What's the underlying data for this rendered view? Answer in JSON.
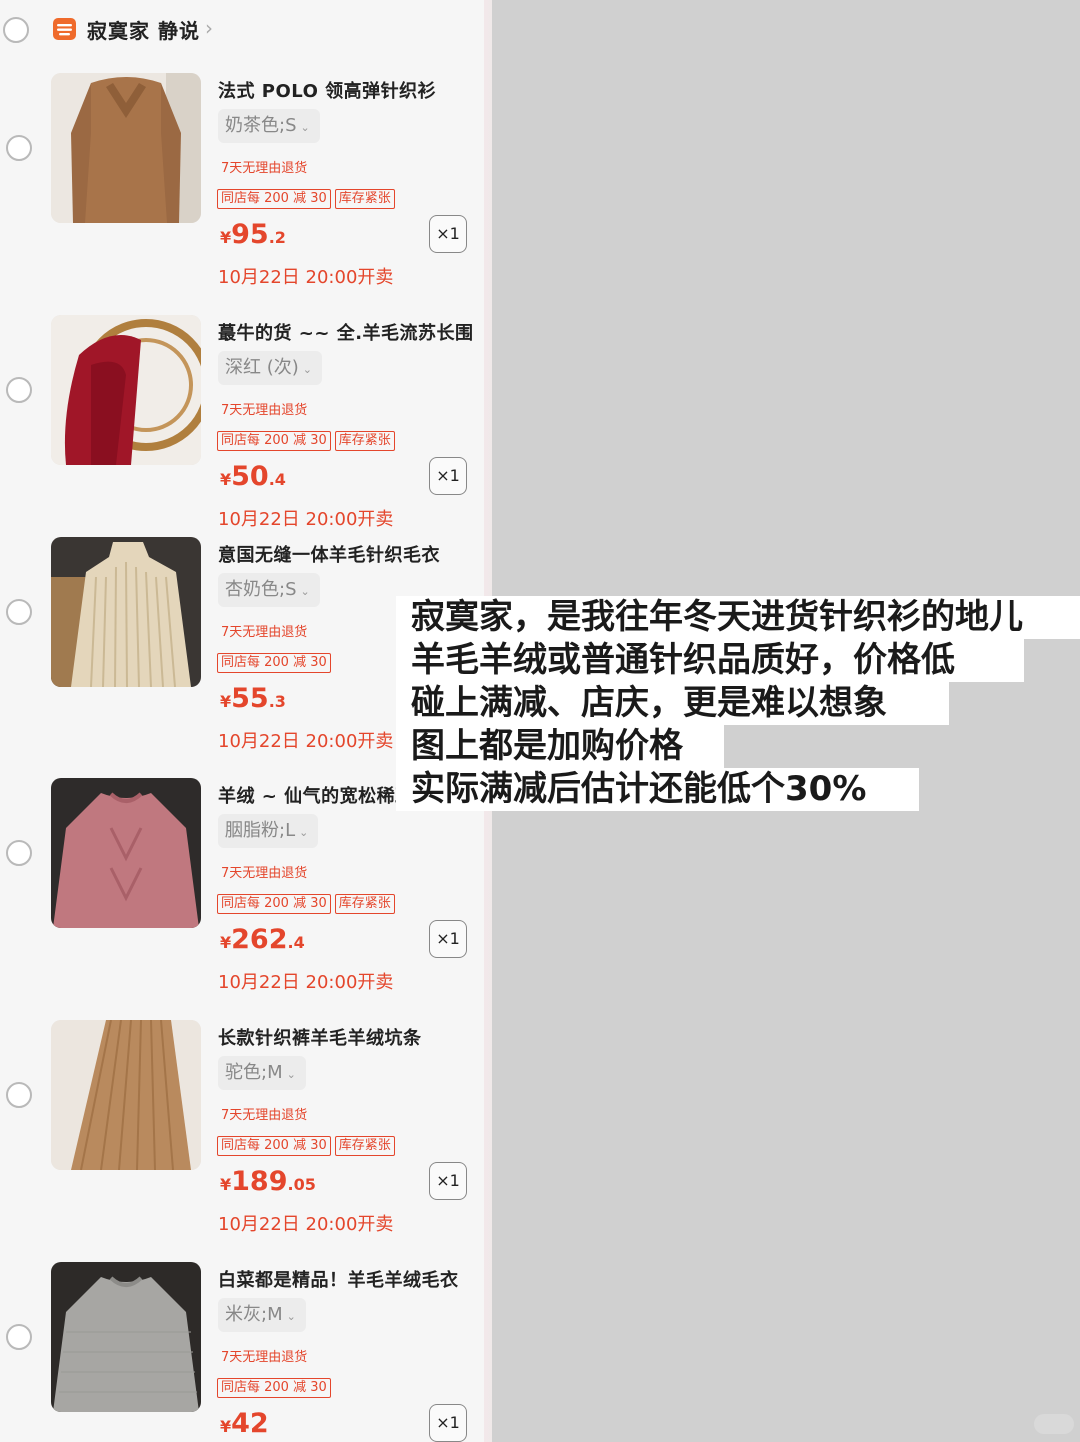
{
  "shop": {
    "name": "寂寞家 静说",
    "chevron": "›"
  },
  "items": [
    {
      "title": "法式 POLO 领高弹针织衫",
      "sku": "奶茶色;S",
      "return_policy": "7天无理由退货",
      "tags": [
        "同店每 200 减 30",
        "库存紧张"
      ],
      "price_currency": "¥",
      "price_int": "95",
      "price_dec": ".2",
      "qty": "×1",
      "sale_time": "10月22日 20:00开卖"
    },
    {
      "title": "蕞牛的货 ~~ 全.羊毛流苏长围",
      "sku": "深红 (次)",
      "return_policy": "7天无理由退货",
      "tags": [
        "同店每 200 减 30",
        "库存紧张"
      ],
      "price_currency": "¥",
      "price_int": "50",
      "price_dec": ".4",
      "qty": "×1",
      "sale_time": "10月22日 20:00开卖"
    },
    {
      "title": "意国无缝一体羊毛针织毛衣",
      "sku": "杏奶色;S",
      "return_policy": "7天无理由退货",
      "tags": [
        "同店每 200 减 30"
      ],
      "price_currency": "¥",
      "price_int": "55",
      "price_dec": ".3",
      "qty": "×1",
      "sale_time": "10月22日 20:00开卖"
    },
    {
      "title": "羊绒 ~ 仙气的宽松稀疏",
      "sku": "胭脂粉;L",
      "return_policy": "7天无理由退货",
      "tags": [
        "同店每 200 减 30",
        "库存紧张"
      ],
      "price_currency": "¥",
      "price_int": "262",
      "price_dec": ".4",
      "qty": "×1",
      "sale_time": "10月22日 20:00开卖"
    },
    {
      "title": "长款针织裤羊毛羊绒坑条",
      "sku": "驼色;M",
      "return_policy": "7天无理由退货",
      "tags": [
        "同店每 200 减 30",
        "库存紧张"
      ],
      "price_currency": "¥",
      "price_int": "189",
      "price_dec": ".05",
      "qty": "×1",
      "sale_time": "10月22日 20:00开卖"
    },
    {
      "title": "白菜都是精品！羊毛羊绒毛衣",
      "sku": "米灰;M",
      "return_policy": "7天无理由退货",
      "tags": [
        "同店每 200 减 30"
      ],
      "price_currency": "¥",
      "price_int": "42",
      "price_dec": "",
      "qty": "×1",
      "sale_time": ""
    }
  ],
  "overlay_lines": [
    "寂寞家，是我往年冬天进货针织衫的地儿",
    "羊毛羊绒或普通针织品质好，价格低",
    "碰上满减、店庆，更是难以想象",
    "图上都是加购价格",
    "实际满减后估计还能低个30%"
  ],
  "colors": {
    "accent": "#e4462c",
    "panel_bg": "#f6f6f6",
    "right_bg": "#d0d0d0"
  },
  "icons": [
    "shop-icon",
    "chevron-right-icon",
    "chevron-down-icon",
    "radio-button"
  ]
}
